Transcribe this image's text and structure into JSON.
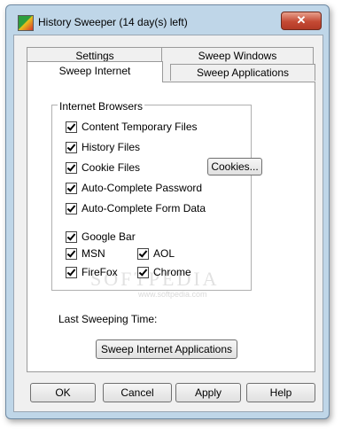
{
  "window": {
    "title": "History Sweeper (14 day(s) left)",
    "close_glyph": "✕"
  },
  "tabs": {
    "back_row": [
      "Settings",
      "Sweep Windows"
    ],
    "front_row": [
      "Sweep Internet",
      "Sweep Applications"
    ],
    "active": "Sweep Internet"
  },
  "group": {
    "title": "Internet Browsers",
    "items": [
      {
        "label": "Content Temporary Files",
        "checked": true
      },
      {
        "label": "History Files",
        "checked": true
      },
      {
        "label": "Cookie Files",
        "checked": true
      },
      {
        "label": "Auto-Complete Password",
        "checked": true
      },
      {
        "label": "Auto-Complete Form Data",
        "checked": true
      },
      {
        "label": "Google Bar",
        "checked": true
      },
      {
        "label": "MSN",
        "checked": true
      },
      {
        "label": "AOL",
        "checked": true
      },
      {
        "label": "FireFox",
        "checked": true
      },
      {
        "label": "Chrome",
        "checked": true
      }
    ],
    "cookies_button": "Cookies..."
  },
  "last_sweep_label": "Last Sweeping Time:",
  "sweep_button": "Sweep Internet Applications",
  "watermark": {
    "text": "SOFTPEDIA",
    "sub": "www.softpedia.com"
  },
  "footer_buttons": [
    "OK",
    "Cancel",
    "Apply",
    "Help"
  ],
  "colors": {
    "window_frame": "#bfd6e8",
    "close_button": "#c44a34",
    "dialog_bg": "#f0f0f0"
  }
}
